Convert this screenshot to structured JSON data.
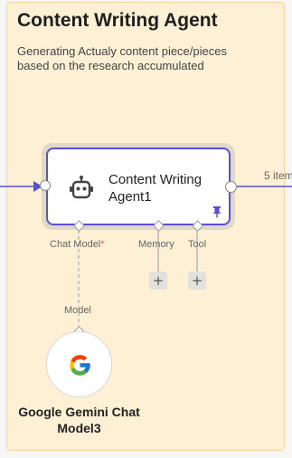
{
  "sticky": {
    "title": "Content Writing Agent",
    "description": "Generating Actualy content piece/pieces based on the research accumulated"
  },
  "agent_node": {
    "name": "Content Writing Agent1",
    "output_items": "5 item",
    "accent_color": "#5b4fd6",
    "icon": "robot-icon"
  },
  "sub_inputs": {
    "chat_model": "Chat Model",
    "required_marker": "*",
    "memory": "Memory",
    "tool": "Tool",
    "add_symbol": "+"
  },
  "model_node": {
    "connection_label": "Model",
    "name": "Google Gemini Chat Model3",
    "icon": "google-icon"
  },
  "colors": {
    "sticky_bg": "#fdf0d5",
    "connection": "#5b4fd6",
    "required": "#e4556b"
  }
}
